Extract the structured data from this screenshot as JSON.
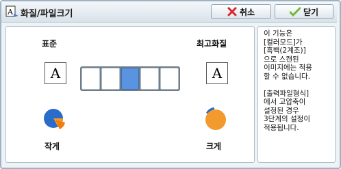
{
  "window": {
    "title": "화질/파일크기",
    "cancel_label": "취소",
    "close_label": "닫기"
  },
  "quality": {
    "left_label": "표준",
    "right_label": "최고화질",
    "left_glyph": "A",
    "right_glyph": "A",
    "small_label": "작게",
    "large_label": "크게",
    "levels": 5,
    "selected_level": 3
  },
  "info": {
    "text": "이 기능은\n[컬러모드]가\n[흑백(2계조)]\n으로 스캔된\n이미지에는 적용\n할 수 없습니다.\n\n[출력파일형식]\n에서 고압축이\n설정된 경우\n3단계의 설정이\n적용됩니다."
  },
  "colors": {
    "accent": "#5a94e0",
    "cancel_icon": "#d9262c",
    "close_icon": "#6fb83a"
  }
}
